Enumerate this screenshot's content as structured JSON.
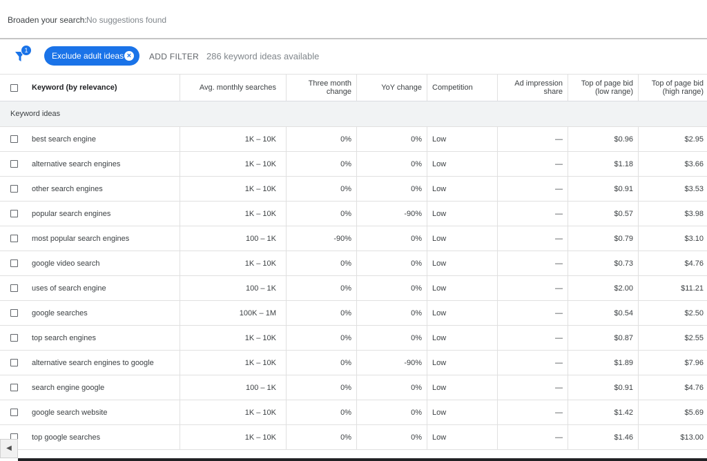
{
  "broaden": {
    "label": "Broaden your search:",
    "value": "No suggestions found"
  },
  "filters": {
    "badge_count": "1",
    "chip_label": "Exclude adult ideas",
    "add_filter": "ADD FILTER",
    "available": "286 keyword ideas available"
  },
  "columns": {
    "keyword": "Keyword (by relevance)",
    "avg_searches": "Avg. monthly searches",
    "three_month": "Three month change",
    "yoy": "YoY change",
    "competition": "Competition",
    "ad_impression": "Ad impression share",
    "bid_low": "Top of page bid (low range)",
    "bid_high": "Top of page bid (high range)"
  },
  "group_label": "Keyword ideas",
  "rows": [
    {
      "keyword": "best search engine",
      "avg": "1K – 10K",
      "three_month": "0%",
      "yoy": "0%",
      "competition": "Low",
      "impression": "—",
      "bid_low": "$0.96",
      "bid_high": "$2.95"
    },
    {
      "keyword": "alternative search engines",
      "avg": "1K – 10K",
      "three_month": "0%",
      "yoy": "0%",
      "competition": "Low",
      "impression": "—",
      "bid_low": "$1.18",
      "bid_high": "$3.66"
    },
    {
      "keyword": "other search engines",
      "avg": "1K – 10K",
      "three_month": "0%",
      "yoy": "0%",
      "competition": "Low",
      "impression": "—",
      "bid_low": "$0.91",
      "bid_high": "$3.53"
    },
    {
      "keyword": "popular search engines",
      "avg": "1K – 10K",
      "three_month": "0%",
      "yoy": "-90%",
      "competition": "Low",
      "impression": "—",
      "bid_low": "$0.57",
      "bid_high": "$3.98"
    },
    {
      "keyword": "most popular search engines",
      "avg": "100 – 1K",
      "three_month": "-90%",
      "yoy": "0%",
      "competition": "Low",
      "impression": "—",
      "bid_low": "$0.79",
      "bid_high": "$3.10"
    },
    {
      "keyword": "google video search",
      "avg": "1K – 10K",
      "three_month": "0%",
      "yoy": "0%",
      "competition": "Low",
      "impression": "—",
      "bid_low": "$0.73",
      "bid_high": "$4.76"
    },
    {
      "keyword": "uses of search engine",
      "avg": "100 – 1K",
      "three_month": "0%",
      "yoy": "0%",
      "competition": "Low",
      "impression": "—",
      "bid_low": "$2.00",
      "bid_high": "$11.21"
    },
    {
      "keyword": "google searches",
      "avg": "100K – 1M",
      "three_month": "0%",
      "yoy": "0%",
      "competition": "Low",
      "impression": "—",
      "bid_low": "$0.54",
      "bid_high": "$2.50"
    },
    {
      "keyword": "top search engines",
      "avg": "1K – 10K",
      "three_month": "0%",
      "yoy": "0%",
      "competition": "Low",
      "impression": "—",
      "bid_low": "$0.87",
      "bid_high": "$2.55"
    },
    {
      "keyword": "alternative search engines to google",
      "avg": "1K – 10K",
      "three_month": "0%",
      "yoy": "-90%",
      "competition": "Low",
      "impression": "—",
      "bid_low": "$1.89",
      "bid_high": "$7.96"
    },
    {
      "keyword": "search engine google",
      "avg": "100 – 1K",
      "three_month": "0%",
      "yoy": "0%",
      "competition": "Low",
      "impression": "—",
      "bid_low": "$0.91",
      "bid_high": "$4.76"
    },
    {
      "keyword": "google search website",
      "avg": "1K – 10K",
      "three_month": "0%",
      "yoy": "0%",
      "competition": "Low",
      "impression": "—",
      "bid_low": "$1.42",
      "bid_high": "$5.69"
    },
    {
      "keyword": "top google searches",
      "avg": "1K – 10K",
      "three_month": "0%",
      "yoy": "0%",
      "competition": "Low",
      "impression": "—",
      "bid_low": "$1.46",
      "bid_high": "$13.00"
    }
  ],
  "icons": {
    "filter": "filter-funnel-icon",
    "chip_close": "close-circle-icon",
    "scroll_left": "chevron-left-icon"
  },
  "colors": {
    "accent": "#1a73e8",
    "group_bg": "#f1f3f4"
  }
}
